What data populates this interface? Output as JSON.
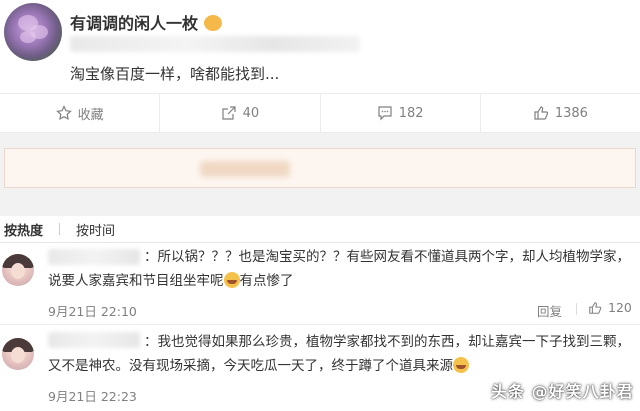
{
  "post": {
    "username": "有调调的闲人一枚",
    "text_tail": "淘宝像百度一样，啥都能找到..."
  },
  "actions": {
    "favorite_label": "收藏",
    "share_count": "40",
    "comment_count": "182",
    "like_count": "1386"
  },
  "sort": {
    "hot_label": "按热度",
    "time_label": "按时间"
  },
  "comments": [
    {
      "line1": "：所以锅？？？也是淘宝买的？？有些网友看不懂道具两个字，却人均植物学家，",
      "line2_a": "说要人家嘉宾和节目组坐牢呢",
      "line2_b": "有点惨了",
      "time": "9月21日 22:10",
      "reply_label": "回复",
      "likes": "120"
    },
    {
      "line1": "：我也觉得如果那么珍贵，植物学家都找不到的东西，却让嘉宾一下子找到三颗，",
      "line2": "又不是神农。没有现场采摘，今天吃瓜一天了，终于蹲了个道具来源",
      "time": "9月21日 22:23"
    }
  ],
  "watermark": "头条 @好笑八卦君",
  "colors": {
    "accent_gray": "#808080",
    "band": "#f2f2f2"
  }
}
